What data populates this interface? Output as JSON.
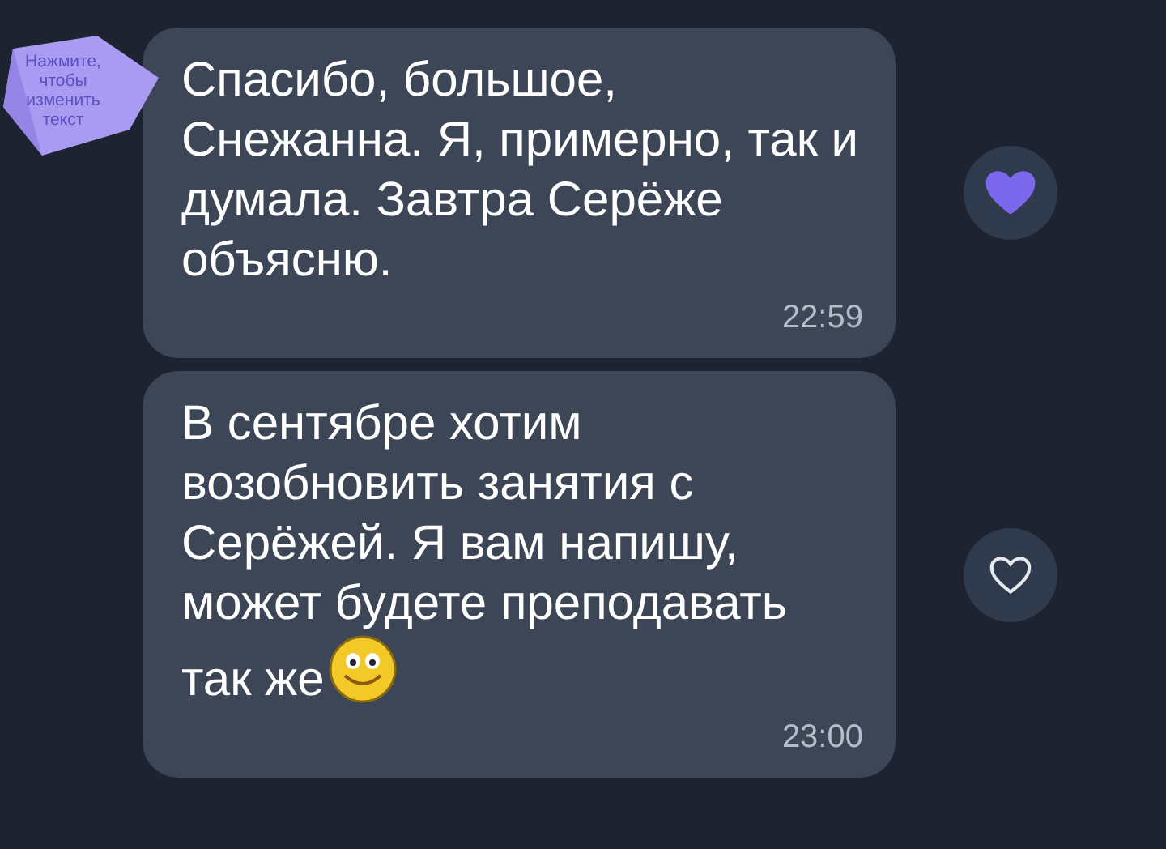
{
  "sticker": {
    "text": "Нажмите, чтобы изменить текст"
  },
  "messages": [
    {
      "text": "Спасибо, большое, Снежанна. Я, примерно, так и думала. Завтра Серёже объясню.",
      "smiley": false,
      "time": "22:59",
      "liked": true
    },
    {
      "text": "В сентябре хотим возобновить занятия с Серёжей. Я вам напишу, может будете преподавать так же",
      "smiley": true,
      "time": "23:00",
      "liked": false
    }
  ]
}
